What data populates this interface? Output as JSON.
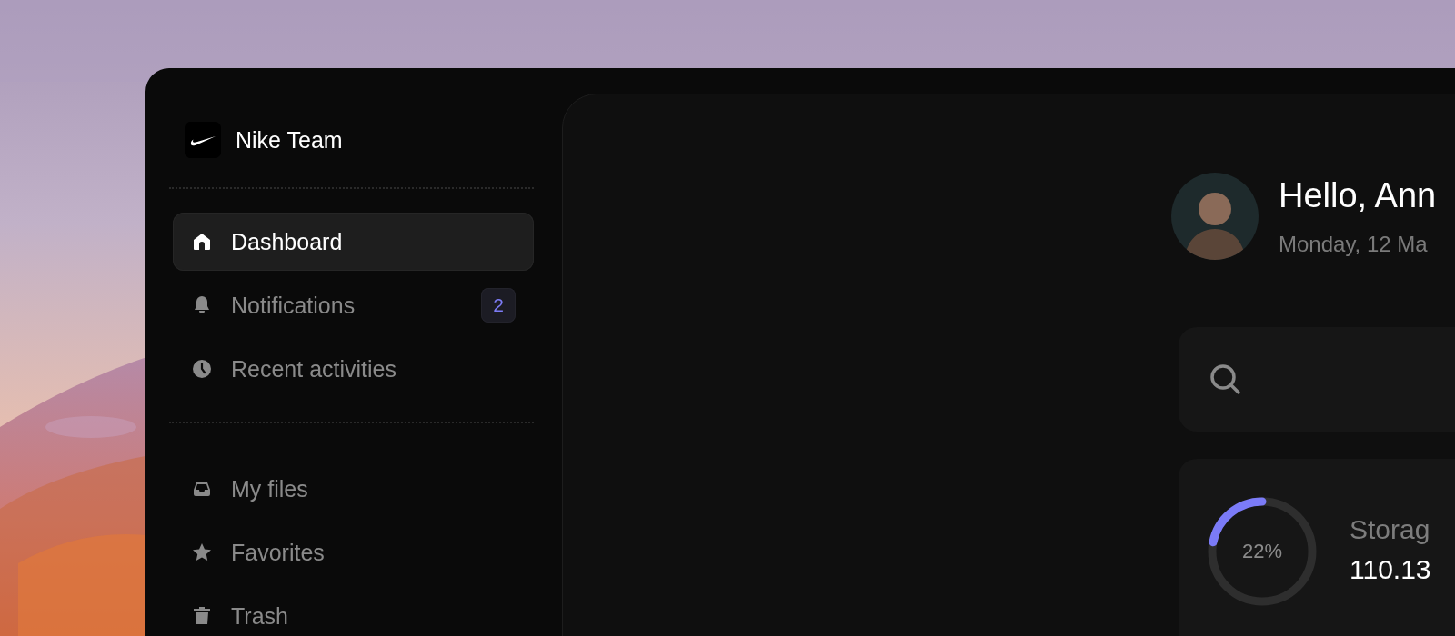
{
  "team": {
    "name": "Nike Team"
  },
  "nav": [
    {
      "label": "Dashboard",
      "selected": true
    },
    {
      "label": "Notifications",
      "selected": false,
      "badge": "2"
    },
    {
      "label": "Recent activities",
      "selected": false
    }
  ],
  "files_nav": [
    {
      "label": "My files",
      "selected": false
    },
    {
      "label": "Favorites",
      "selected": false
    },
    {
      "label": "Trash",
      "selected": false
    }
  ],
  "greeting": {
    "title": "Hello, Ann",
    "date": "Monday, 12 Ma"
  },
  "storage": {
    "level": 0.22,
    "percent": "22%",
    "label": "Storag",
    "used": "110.13"
  }
}
